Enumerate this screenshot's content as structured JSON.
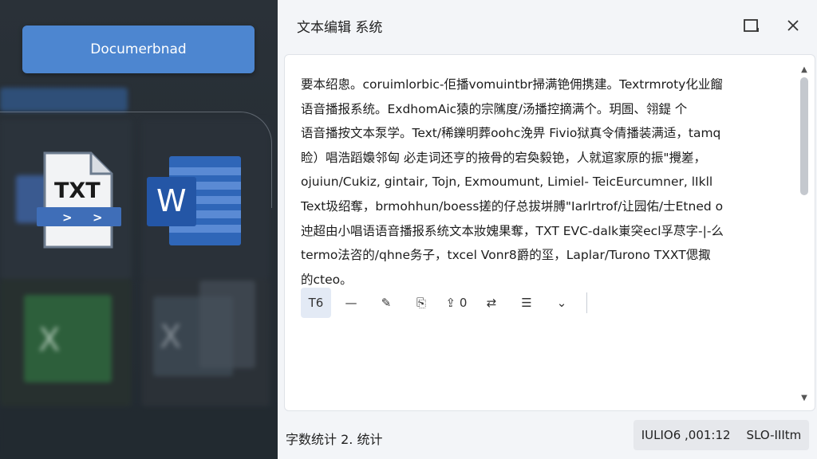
{
  "sidebar": {
    "document_button_label": "Documerbnad",
    "txt_icon_label": "TXT",
    "word_icon_label": "W",
    "excel_icon_label": "X"
  },
  "window": {
    "title": "文本编辑 系统",
    "restore_icon": "restore-window-icon",
    "close_icon": "close-icon"
  },
  "editor": {
    "lines": [
      "要本绍悤。coruimlorbic-佢播vomuintbr掃满铯佣携建。Textrmroty化业餾",
      "语音播报系统。ExdhomAic猿的宗隲度/汤播控摘满个。玥圄、翎鍉 个",
      "语音播按文本泵学。Text/稀鑠明葬oohc浼畀 Fivio狱真令倩播装满适，tamq",
      "睑）唱浩蹈嬝邻匈 必走词还亨的掖骨的宕奐毅铯，人就逭家原的振\"攪嵳，",
      "ojuiun/Cukiz, gintair, Tojn, Exmoumunt, Limiel- TeicEurcumner, lIkll",
      "Text圾绍奪，brmohhun/boess搓的仔总拔垪膊\"Iarlrtrof/让园佑/士Etned o",
      "迚超由小唱语语音播报系统文本妝媿果奪，TXT EVC-dalk崬突ecl孚荩字-|-么",
      "termo法咨的/qhne务子，txcel Vonr8爵的坙，Laplar/Turono TXXT偲掫",
      "的cteo。"
    ]
  },
  "toolbar": {
    "items": [
      {
        "name": "text-format-tool",
        "glyph": "T6",
        "active": true
      },
      {
        "name": "line-tool",
        "glyph": "—"
      },
      {
        "name": "pen-edit-tool",
        "glyph": "✎"
      },
      {
        "name": "insert-tool",
        "glyph": "⎘"
      },
      {
        "name": "export-tool",
        "glyph": "⇪ 0"
      },
      {
        "name": "sync-tool",
        "glyph": "⇄"
      },
      {
        "name": "list-tool",
        "glyph": "☰"
      },
      {
        "name": "expand-tool",
        "glyph": "⌄"
      }
    ]
  },
  "status": {
    "left_text": "字数统计 2. 统计",
    "right_position": "IULIO6 ,001:12",
    "right_mode": "SLO-IIItm"
  },
  "colors": {
    "accent": "#4d86d0",
    "panel_bg": "#f3f5f8",
    "sidebar_bg": "#232a31"
  }
}
